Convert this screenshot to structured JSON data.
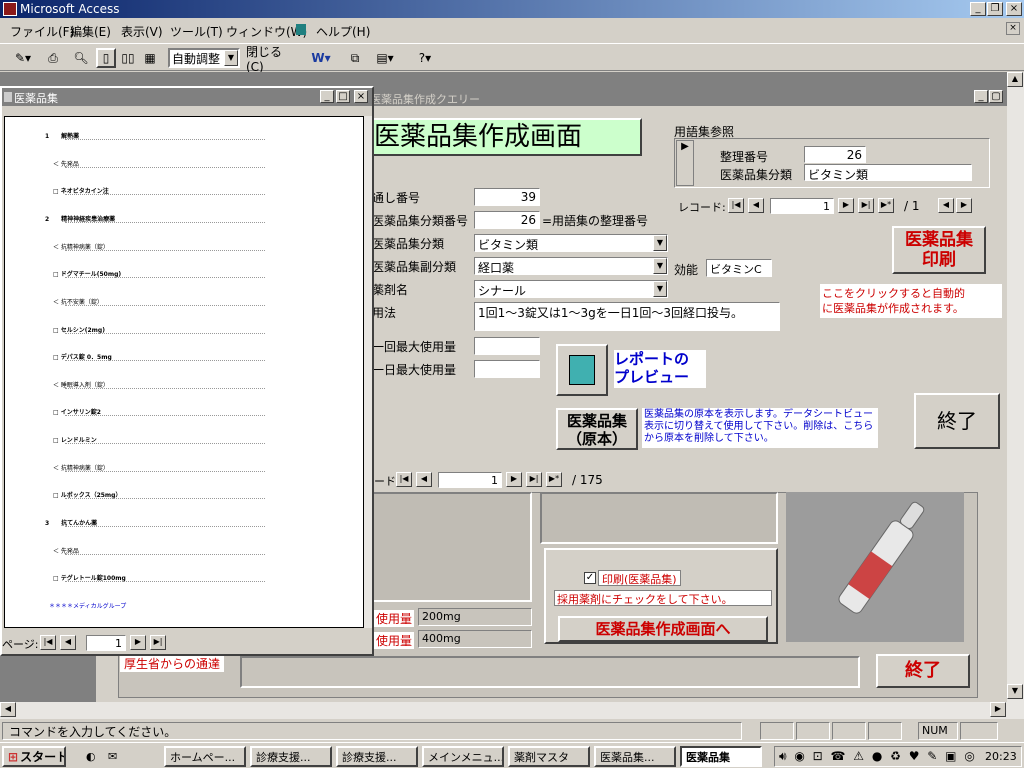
{
  "app": {
    "title": "Microsoft Access"
  },
  "menu": [
    "ファイル(F)",
    "編集(E)",
    "表示(V)",
    "ツール(T)",
    "ウィンドウ(W)",
    "ヘルプ(H)"
  ],
  "toolbar": {
    "zoom_value": "自動調整",
    "close_label": "閉じる(C)"
  },
  "query_window": {
    "title": "医薬品集作成クエリー"
  },
  "form": {
    "heading": "医薬品集作成画面",
    "ref_group_label": "用語集参照",
    "ref_number_label": "整理番号",
    "ref_number_value": "26",
    "ref_category_label": "医薬品集分類",
    "ref_category_value": "ビタミン類",
    "ref_record_label": "レコード:",
    "ref_record_value": "1",
    "ref_record_total": "/ 1",
    "fields": {
      "serial_label": "通し番号",
      "serial_value": "39",
      "catno_label": "医薬品集分類番号",
      "catno_value": "26",
      "catno_note": "=用語集の整理番号",
      "cat_label": "医薬品集分類",
      "cat_value": "ビタミン類",
      "subcat_label": "医薬品集副分類",
      "subcat_value": "経口薬",
      "effect_label": "効能",
      "effect_value": "ビタミンC",
      "drug_label": "薬剤名",
      "drug_value": "シナール",
      "usage_label": "用法",
      "usage_value": "1回1～3錠又は1～3gを一日1回～3回経口投与。",
      "max_once_label": "一回最大使用量",
      "max_day_label": "一日最大使用量"
    },
    "print_button": "医薬品集\n印刷",
    "print_note": "ここをクリックすると自動的\nに医薬品集が作成されます。",
    "report_preview_label": "レポートの\nプレビュー",
    "original_button": "医薬品集\n（原本）",
    "original_note": "医薬品集の原本を表示します。データシートビュー表示に切り替えて使用して下さい。削除は、こちらから原本を削除して下さい。",
    "exit_button": "終了",
    "record_label": "レコード:",
    "record_value": "1",
    "record_total": "/ 175"
  },
  "lower": {
    "usage1_label": "使用量",
    "usage1_value": "200mg",
    "usage2_label": "使用量",
    "usage2_value": "400mg",
    "notice_label": "厚生省からの通達",
    "print_check_label": "印刷(医薬品集)",
    "check_note": "採用薬剤にチェックをして下さい。",
    "goto_button": "医薬品集作成画面へ",
    "exit_button": "終了"
  },
  "preview": {
    "title": "医薬品集",
    "page_label": "ページ:",
    "page_value": "1",
    "lines": [
      {
        "t": "1　　解熱薬",
        "bold": true
      },
      {
        "t": "＜ 先発品",
        "bold": false
      },
      {
        "t": "□ ネオビタカイン注",
        "bold": true
      },
      {
        "t": "2　　精神神経疾患治療薬",
        "bold": true
      },
      {
        "t": "＜ 抗精神病薬（錠）",
        "bold": false
      },
      {
        "t": "□ ドグマチール(50mg)",
        "bold": true
      },
      {
        "t": "＜ 抗不安薬（錠）",
        "bold": false
      },
      {
        "t": "□ セルシン(2mg)",
        "bold": true
      },
      {
        "t": "□ デパス錠 0．5mg",
        "bold": true
      },
      {
        "t": "＜ 睡眠導入剤（錠）",
        "bold": false
      },
      {
        "t": "□ インサリン錠2",
        "bold": true
      },
      {
        "t": "□ レンドルミン",
        "bold": true
      },
      {
        "t": "＜ 抗精神病薬（錠）",
        "bold": false
      },
      {
        "t": "□ ルボックス（25mg）",
        "bold": true
      },
      {
        "t": "3　　抗てんかん薬",
        "bold": true
      },
      {
        "t": "＜ 先発品",
        "bold": false
      },
      {
        "t": "□ テグレトール錠100mg",
        "bold": true
      }
    ]
  },
  "status": {
    "message": "コマンドを入力してください。",
    "num": "NUM"
  },
  "taskbar": {
    "start": "スタート",
    "tasks": [
      "ホームペー...",
      "診療支援...",
      "診療支援...",
      "メインメニュ...",
      "薬剤マスタ",
      "医薬品集...",
      "医薬品集"
    ],
    "clock": "20:23"
  },
  "colors": {
    "title_start": "#0a246a",
    "title_end": "#a6caf0",
    "heading_bg": "#ccffcc",
    "red": "#cc0000",
    "blue": "#0000cc"
  }
}
